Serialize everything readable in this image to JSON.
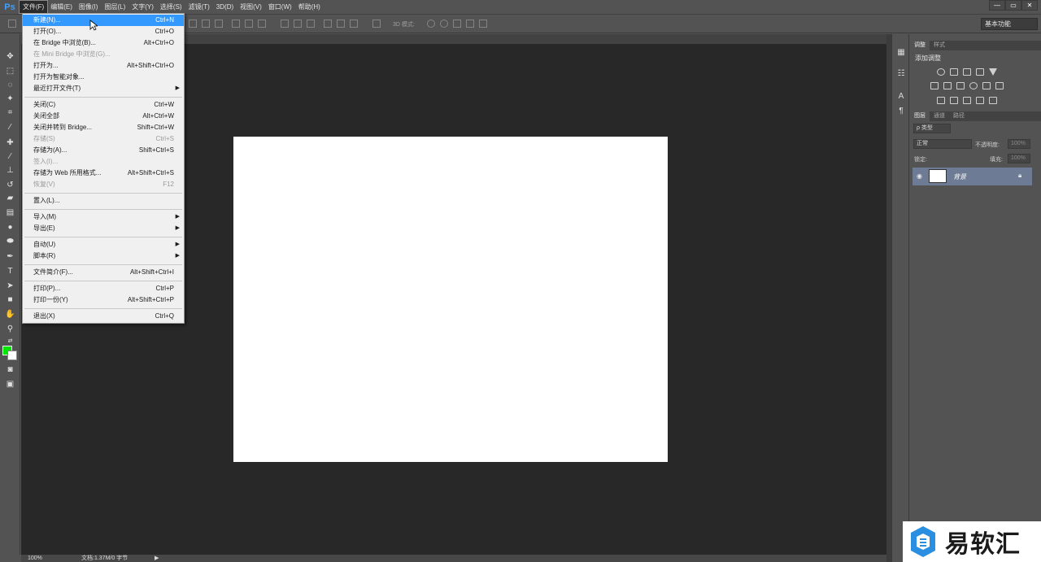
{
  "app": {
    "logo": "Ps"
  },
  "menubar": {
    "items": [
      "文件(F)",
      "编辑(E)",
      "图像(I)",
      "图层(L)",
      "文字(Y)",
      "选择(S)",
      "滤镜(T)",
      "3D(D)",
      "视图(V)",
      "窗口(W)",
      "帮助(H)"
    ]
  },
  "window_controls": [
    "—",
    "▭",
    "✕"
  ],
  "options_bar": {
    "mode_3d_label": "3D 模式:",
    "workspace": "基本功能"
  },
  "file_menu": {
    "items": [
      {
        "label": "新建(N)...",
        "shortcut": "Ctrl+N",
        "state": "hover"
      },
      {
        "label": "打开(O)...",
        "shortcut": "Ctrl+O"
      },
      {
        "label": "在 Bridge 中浏览(B)...",
        "shortcut": "Alt+Ctrl+O"
      },
      {
        "label": "在 Mini Bridge 中浏览(G)...",
        "shortcut": "",
        "state": "disabled"
      },
      {
        "label": "打开为...",
        "shortcut": "Alt+Shift+Ctrl+O"
      },
      {
        "label": "打开为智能对象...",
        "shortcut": ""
      },
      {
        "label": "最近打开文件(T)",
        "shortcut": "",
        "submenu": true
      },
      {
        "separator": true
      },
      {
        "label": "关闭(C)",
        "shortcut": "Ctrl+W"
      },
      {
        "label": "关闭全部",
        "shortcut": "Alt+Ctrl+W"
      },
      {
        "label": "关闭并转到 Bridge...",
        "shortcut": "Shift+Ctrl+W"
      },
      {
        "label": "存储(S)",
        "shortcut": "Ctrl+S",
        "state": "disabled"
      },
      {
        "label": "存储为(A)...",
        "shortcut": "Shift+Ctrl+S"
      },
      {
        "label": "签入(I)...",
        "shortcut": "",
        "state": "disabled"
      },
      {
        "label": "存储为 Web 所用格式...",
        "shortcut": "Alt+Shift+Ctrl+S"
      },
      {
        "label": "恢复(V)",
        "shortcut": "F12",
        "state": "disabled"
      },
      {
        "separator": true
      },
      {
        "label": "置入(L)...",
        "shortcut": ""
      },
      {
        "separator": true
      },
      {
        "label": "导入(M)",
        "shortcut": "",
        "submenu": true
      },
      {
        "label": "导出(E)",
        "shortcut": "",
        "submenu": true
      },
      {
        "separator": true
      },
      {
        "label": "自动(U)",
        "shortcut": "",
        "submenu": true
      },
      {
        "label": "脚本(R)",
        "shortcut": "",
        "submenu": true
      },
      {
        "separator": true
      },
      {
        "label": "文件简介(F)...",
        "shortcut": "Alt+Shift+Ctrl+I"
      },
      {
        "separator": true
      },
      {
        "label": "打印(P)...",
        "shortcut": "Ctrl+P"
      },
      {
        "label": "打印一份(Y)",
        "shortcut": "Alt+Shift+Ctrl+P"
      },
      {
        "separator": true
      },
      {
        "label": "退出(X)",
        "shortcut": "Ctrl+Q"
      }
    ]
  },
  "colors": {
    "foreground": "#00e600",
    "background": "#ffffff",
    "menu_highlight": "#3399ff",
    "layer_selected": "#6d7b95"
  },
  "status_bar": {
    "zoom": "100%",
    "doc_info": "文档:1.37M/0 字节",
    "arrow": "▶"
  },
  "adjustments_panel": {
    "tabs": [
      "调整",
      "样式"
    ],
    "title": "添加调整"
  },
  "layers_panel": {
    "tabs": [
      "图层",
      "通道",
      "路径"
    ],
    "filter_label": "ρ 类型",
    "blend_mode": "正常",
    "opacity_label": "不透明度:",
    "opacity_value": "100%",
    "lock_label": "锁定:",
    "fill_label": "填充:",
    "fill_value": "100%",
    "layer": {
      "name": "背景"
    }
  },
  "watermark": {
    "text": "易软汇"
  }
}
